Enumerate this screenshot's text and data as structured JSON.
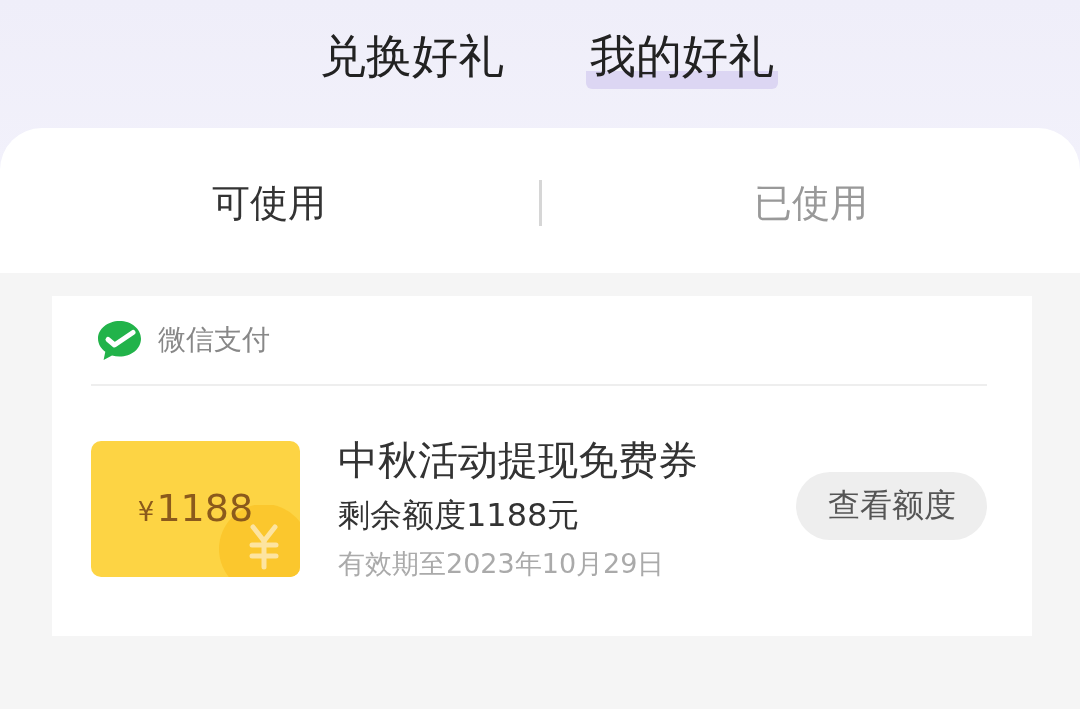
{
  "top_tabs": [
    {
      "label": "兑换好礼",
      "selected": false
    },
    {
      "label": "我的好礼",
      "selected": true
    }
  ],
  "status_tabs": [
    {
      "label": "可使用",
      "selected": true
    },
    {
      "label": "已使用",
      "selected": false
    }
  ],
  "coupon_card": {
    "provider": "微信支付",
    "coupon": {
      "currency": "¥",
      "amount": "1188",
      "title": "中秋活动提现免费券",
      "balance": "剩余额度1188元",
      "validity": "有效期至2023年10月29日",
      "button": "查看额度"
    }
  }
}
